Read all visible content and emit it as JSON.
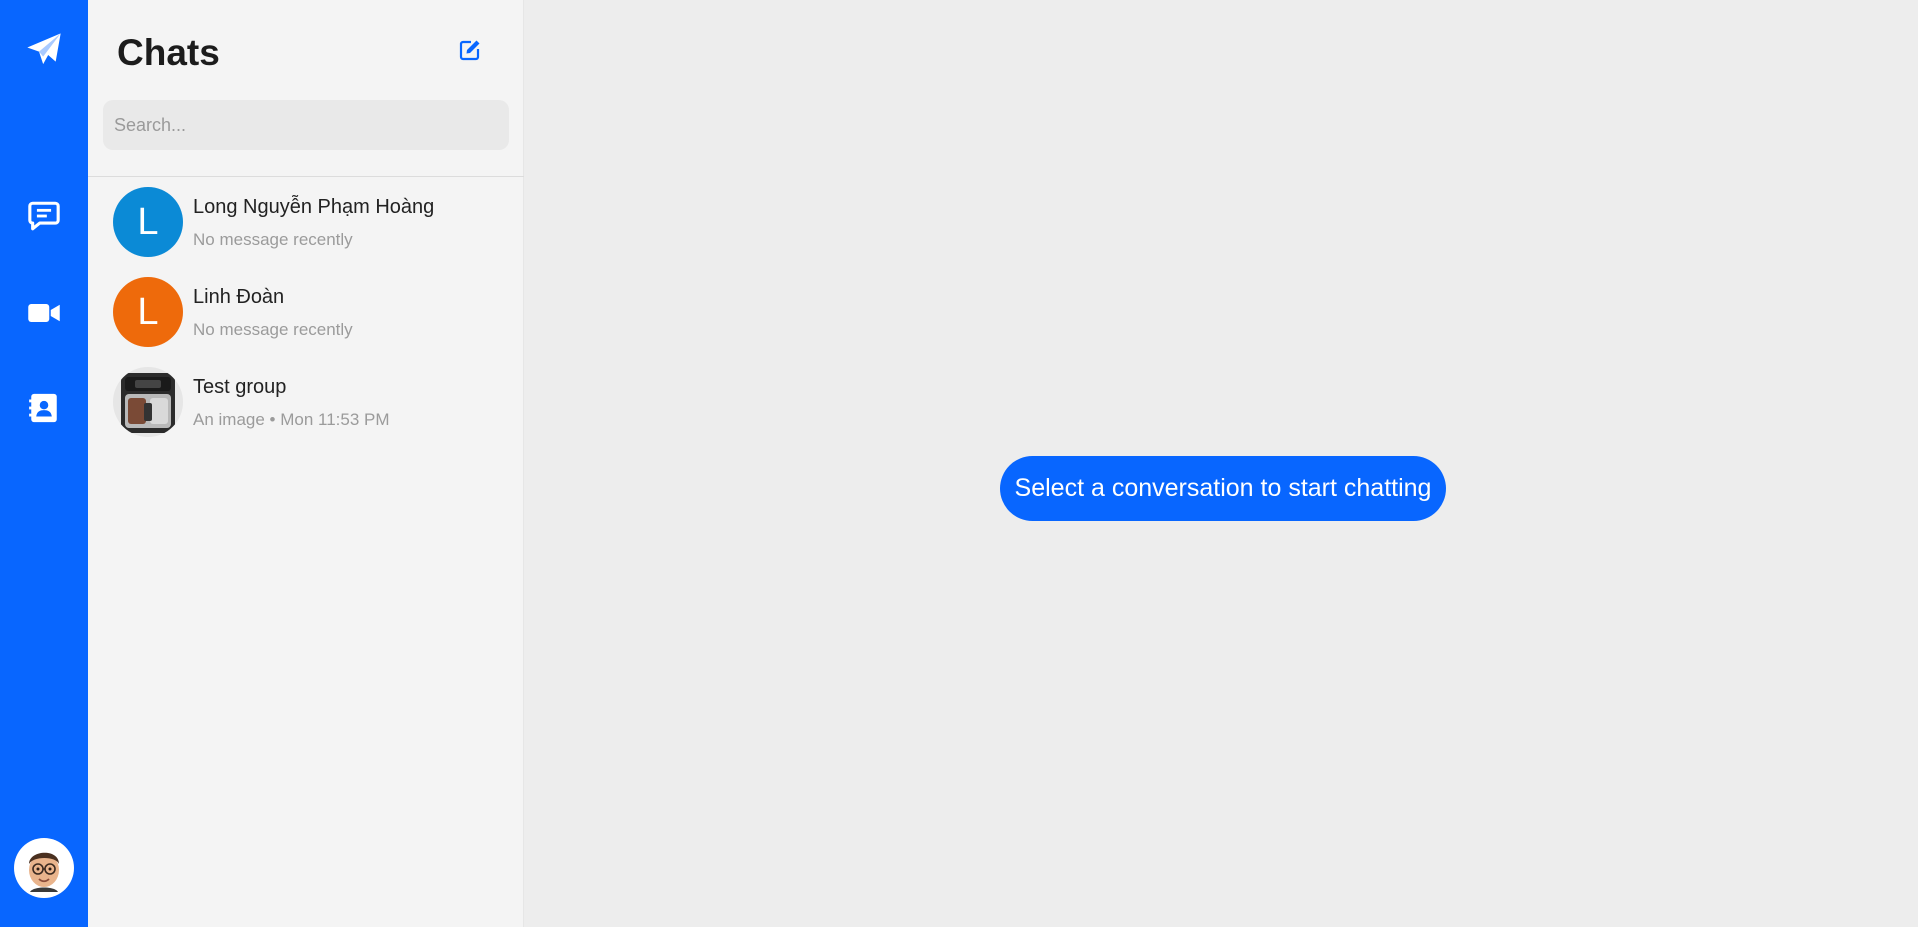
{
  "rail": {
    "icons": [
      "paper-plane-icon",
      "chat-bubble-icon",
      "video-camera-icon",
      "contact-book-icon"
    ],
    "accent": "#0866ff"
  },
  "panel": {
    "title": "Chats",
    "search_placeholder": "Search..."
  },
  "chats": [
    {
      "name": "Long Nguyễn Phạm Hoàng",
      "preview": "No message recently",
      "initial": "L",
      "color": "#0b8ad6"
    },
    {
      "name": "Linh Đoàn",
      "preview": "No message recently",
      "initial": "L",
      "color": "#ee6a0b"
    },
    {
      "name": "Test group",
      "preview": "An image • Mon 11:53 PM",
      "initial": "",
      "color": "#dcdcdc"
    }
  ],
  "main": {
    "cta": "Select a conversation to start chatting"
  }
}
